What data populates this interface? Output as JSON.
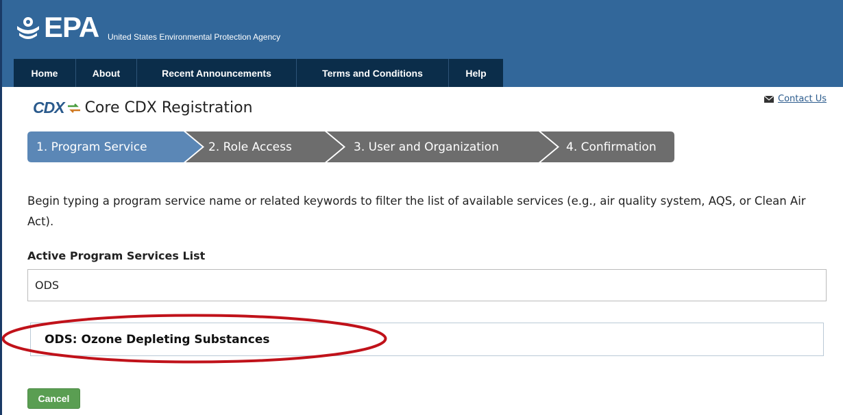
{
  "header": {
    "logo_text": "EPA",
    "agency_name": "United States Environmental Protection Agency"
  },
  "nav": {
    "items": [
      {
        "label": "Home"
      },
      {
        "label": "About"
      },
      {
        "label": "Recent Announcements"
      },
      {
        "label": "Terms and Conditions"
      },
      {
        "label": "Help"
      }
    ]
  },
  "page": {
    "cdx_logo_text": "CDX",
    "title": "Core CDX Registration",
    "contact_label": "Contact Us"
  },
  "steps": [
    {
      "label": "1. Program Service",
      "active": true
    },
    {
      "label": "2. Role Access",
      "active": false
    },
    {
      "label": "3. User and Organization",
      "active": false
    },
    {
      "label": "4. Confirmation",
      "active": false
    }
  ],
  "instructions": "Begin typing a program service name or related keywords to filter the list of available services (e.g., air quality system, AQS, or Clean Air Act).",
  "services": {
    "label": "Active Program Services List",
    "search_value": "ODS",
    "results": [
      {
        "label": "ODS: Ozone Depleting Substances"
      }
    ]
  },
  "actions": {
    "cancel_label": "Cancel"
  },
  "colors": {
    "header_bg": "#32679a",
    "nav_bg": "#0b2d4a",
    "step_active": "#5b87b6",
    "step_inactive": "#6d6d6d",
    "highlight_ring": "#c0121a",
    "cancel_bg": "#5a9e52"
  }
}
